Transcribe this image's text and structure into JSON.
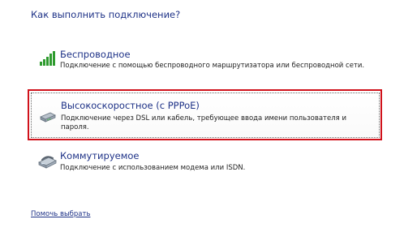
{
  "heading": "Как выполнить подключение?",
  "options": [
    {
      "id": "wireless",
      "icon": "wireless-signal-icon",
      "title": "Беспроводное",
      "description": "Подключение с помощью беспроводного маршрутизатора или беспроводной сети."
    },
    {
      "id": "pppoe",
      "icon": "broadband-modem-icon",
      "title": "Высокоскоростное (с PPPoE)",
      "description": "Подключение через DSL или кабель, требующее ввода имени пользователя и пароля."
    },
    {
      "id": "dialup",
      "icon": "dialup-modem-icon",
      "title": "Коммутируемое",
      "description": "Подключение с использованием модема или ISDN."
    }
  ],
  "help_link": "Помочь выбрать",
  "colors": {
    "link_blue": "#1e3287",
    "selection_red": "#d0121b",
    "signal_green": "#2e9b2e"
  }
}
